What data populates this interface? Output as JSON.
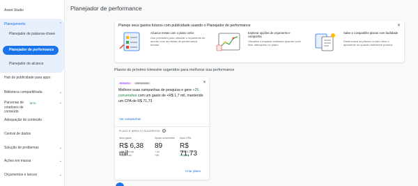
{
  "sidebar": {
    "items": [
      {
        "label": "Asset Studio"
      },
      {
        "label": "Planejamento"
      },
      {
        "label": "Hub de publicidade para apps"
      },
      {
        "label": "Biblioteca compartilhada"
      },
      {
        "label": "Parcerias de criadores de conteúdo",
        "badge": "BETA"
      },
      {
        "label": "Adequação do conteúdo"
      },
      {
        "label": "Central de dados"
      },
      {
        "label": "Solução de problemas"
      },
      {
        "label": "Ações em massa"
      },
      {
        "label": "Orçamentos e lances"
      }
    ],
    "sub_items": [
      {
        "label": "Planejador de palavras-chave"
      },
      {
        "label": "Planejador de performance"
      },
      {
        "label": "Planejador de alcance"
      }
    ]
  },
  "header": {
    "title": "Planejador de performance"
  },
  "info_card": {
    "title": "Planeje seus gastos futuros com publicidade usando o Planejador de performance",
    "features": [
      {
        "title": "Alcance metas com o plano certo",
        "desc": "Use previsões para otimizar o orçamento de acordo com as metas de performance futuras"
      },
      {
        "title": "Explorar opções de orçamento e campanha",
        "desc": "Visualize o impacto estimado quando você fizer alterações no plano"
      },
      {
        "title": "Salve e compartilhe planos com facilidade",
        "desc": "Desenvolva os planos no seu ritmo e apresente os quando estiverem prontos"
      }
    ]
  },
  "section_title": "Planos do próximo trimestre sugeridos para melhorar sua performance",
  "plan_card": {
    "tags": [
      "PESQUISA",
      "CONVERSÕES"
    ],
    "desc_prefix": "Melhore suas campanhas de pesquisa e gere ",
    "desc_highlight": "+25 conversões",
    "desc_suffix": " com um gasto de +R$ 1,7 mil, mantendo um CPA de R$ 71,73",
    "link": "Ver campanhas",
    "impact_title": "PLANO E IMPACTO SUGERIDOS",
    "metrics": [
      {
        "label": "Novo gasto",
        "value": "R$ 6,38 mil",
        "sub1": "+ R$ 4,69 mil",
        "sub2": "+R$ 1,7 mil"
      },
      {
        "label": "Novas conversões",
        "value": "89",
        "sub1": "+ 64",
        "sub2": "+25"
      },
      {
        "label": "Novo CPA",
        "value": "R$ 71,73",
        "sub1": "+ R$ 73,17",
        "sub2": "-R$ 1,44"
      }
    ],
    "action": "Criar plano"
  },
  "colors": {
    "accent": "#1a73e8",
    "positive": "#188038",
    "tag_purple": "#9334e6"
  }
}
